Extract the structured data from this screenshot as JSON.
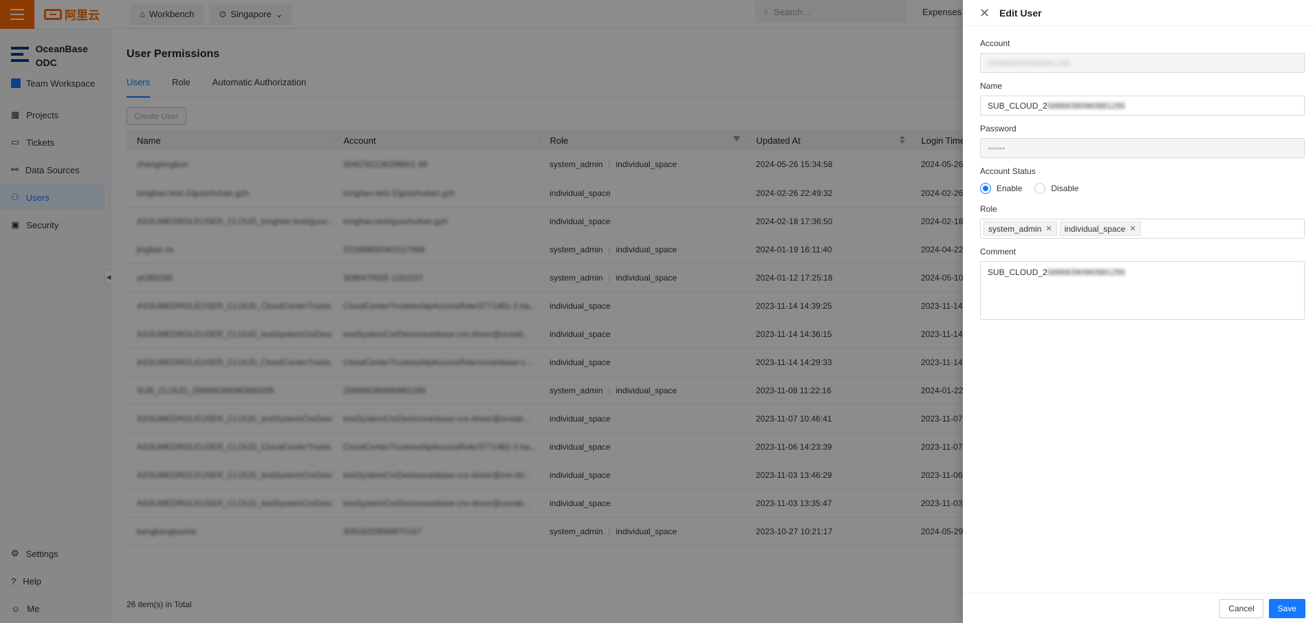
{
  "topbar": {
    "logo_text": "阿里云",
    "workbench": "Workbench",
    "region": "Singapore",
    "search_placeholder": "Search...",
    "expenses": "Expenses"
  },
  "sidenav": {
    "brand": "OceanBase\nODC",
    "workspace": "Team Workspace",
    "items": [
      "Projects",
      "Tickets",
      "Data Sources",
      "Users",
      "Security"
    ],
    "bottom_items": [
      "Settings",
      "Help",
      "Me"
    ]
  },
  "page": {
    "title": "User Permissions",
    "tabs": [
      "Users",
      "Role",
      "Automatic Authorization"
    ],
    "create_button": "Create User",
    "columns": [
      "Name",
      "Account",
      "Role",
      "Updated At",
      "Login Time"
    ],
    "rows": [
      {
        "name": "zhanglongkun",
        "account": "3045781136298001 66",
        "role1": "system_admin",
        "role2": "individual_space",
        "updated": "2024-05-26 15:34:58",
        "login": "2024-05-26"
      },
      {
        "name": "tonghan-test-2/guozhuhan.gzh",
        "account": "tonghan-test-2/guozhuhan.gzh",
        "role1": "individual_space",
        "role2": "",
        "updated": "2024-02-26 22:49:32",
        "login": "2024-02-26"
      },
      {
        "name": "ASSUMEDROLEUSER_CLOUD_tonghan-test/guoz...",
        "account": "tonghan-test/guozhuhan.gzh",
        "role1": "individual_space",
        "role2": "",
        "updated": "2024-02-18 17:36:50",
        "login": "2024-02-18"
      },
      {
        "name": "jingtian.zx",
        "account": "331889093401117668",
        "role1": "system_admin",
        "role2": "individual_space",
        "updated": "2024-01-19 16:11:40",
        "login": "2024-04-22"
      },
      {
        "name": "yk360288",
        "account": "3096470505 1161522",
        "role1": "system_admin",
        "role2": "individual_space",
        "updated": "2024-01-12 17:25:18",
        "login": "2024-05-10"
      },
      {
        "name": "ASSUMEDROLEUSER_CLOUD_CloudCenterTruste...",
        "account": "CloudCenterTrusteeshipAccessRole/3771481-2-ba...",
        "role1": "individual_space",
        "role2": "",
        "updated": "2023-11-14 14:39:25",
        "login": "2023-11-14"
      },
      {
        "name": "ASSUMEDROLEUSER_CLOUD_testSystemCreDes/...",
        "account": "testSystemCreDes/oceanbase-cre-driver@oceab...",
        "role1": "individual_space",
        "role2": "",
        "updated": "2023-11-14 14:36:15",
        "login": "2023-11-14"
      },
      {
        "name": "ASSUMEDROLEUSER_CLOUD_CloudCenterTruste...",
        "account": "CloudCenterTrusteeshipAccessRole/oceanbase-c...",
        "role1": "individual_space",
        "role2": "",
        "updated": "2023-11-14 14:29:33",
        "login": "2023-11-14"
      },
      {
        "name": "SUB_CLOUD_258968390960880295",
        "account": "258968390960881295",
        "role1": "system_admin",
        "role2": "individual_space",
        "updated": "2023-11-08 11:22:16",
        "login": "2024-01-22"
      },
      {
        "name": "ASSUMEDROLEUSER_CLOUD_testSystemCreDes/...",
        "account": "testSystemCreDes/oceanbase-cre-driver@oceab...",
        "role1": "individual_space",
        "role2": "",
        "updated": "2023-11-07 10:46:41",
        "login": "2023-11-07"
      },
      {
        "name": "ASSUMEDROLEUSER_CLOUD_CloudCenterTruste...",
        "account": "CloudCenterTrusteeshipAccessRole/3771481-2-ba...",
        "role1": "individual_space",
        "role2": "",
        "updated": "2023-11-06 14:23:39",
        "login": "2023-11-07"
      },
      {
        "name": "ASSUMEDROLEUSER_CLOUD_testSystemCreDes/...",
        "account": "testSystemCreDes/oceanbase-cre-driver@cre-dri...",
        "role1": "individual_space",
        "role2": "",
        "updated": "2023-11-03 13:46:29",
        "login": "2023-11-06"
      },
      {
        "name": "ASSUMEDROLEUSER_CLOUD_testSystemCreDes/...",
        "account": "testSystemCreDes/oceanbase-cre-driver@oceab...",
        "role1": "individual_space",
        "role2": "",
        "updated": "2023-11-03 13:35:47",
        "login": "2023-11-03"
      },
      {
        "name": "kangkangkaxinb",
        "account": "309183295688T0167",
        "role1": "system_admin",
        "role2": "individual_space",
        "updated": "2023-10-27 10:21:17",
        "login": "2024-05-29"
      }
    ],
    "total": "26 item(s) in Total"
  },
  "drawer": {
    "title": "Edit User",
    "account_label": "Account",
    "account_value": "258968390960881295",
    "name_label": "Name",
    "name_prefix": "SUB_CLOUD_2",
    "name_blur": "58968390960881295",
    "password_label": "Password",
    "password_value": "••••••",
    "status_label": "Account Status",
    "status_enable": "Enable",
    "status_disable": "Disable",
    "role_label": "Role",
    "roles": [
      "system_admin",
      "individual_space"
    ],
    "comment_label": "Comment",
    "comment_prefix": "SUB_CLOUD_2",
    "comment_blur": "58968390960881295",
    "cancel": "Cancel",
    "save": "Save"
  }
}
